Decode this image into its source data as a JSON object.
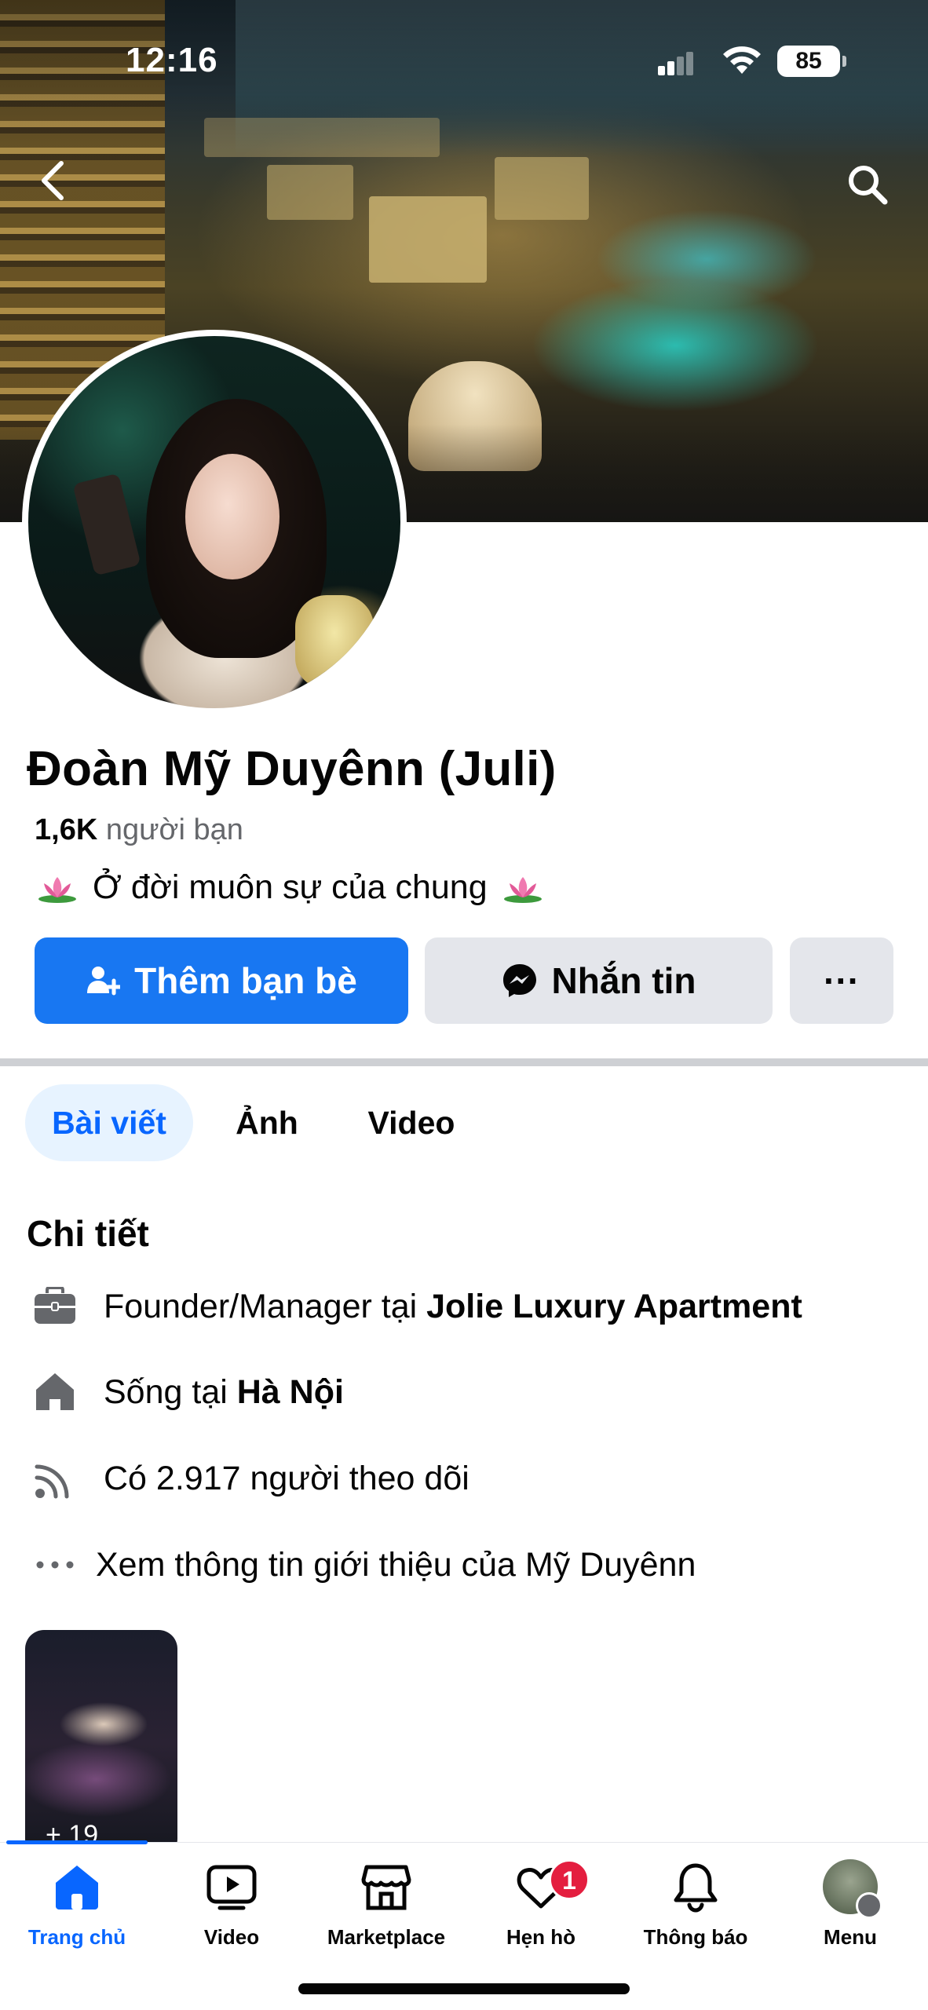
{
  "status_bar": {
    "time": "12:16",
    "battery": "85"
  },
  "profile": {
    "name": "Đoàn Mỹ Duyênn (Juli)",
    "friends_count": "1,6K",
    "friends_label": " người bạn",
    "bio": "Ở đời muôn sự của chung"
  },
  "actions": {
    "add_friend": "Thêm bạn bè",
    "message": "Nhắn tin",
    "more": "···"
  },
  "tabs": [
    {
      "label": "Bài viết",
      "active": true
    },
    {
      "label": "Ảnh",
      "active": false
    },
    {
      "label": "Video",
      "active": false
    }
  ],
  "details": {
    "title": "Chi tiết",
    "work_prefix": "Founder/Manager tại ",
    "work_place": "Jolie Luxury Apartment",
    "lives_prefix": "Sống tại ",
    "lives_place": "Hà Nội",
    "followers": "Có 2.917 người theo dõi",
    "see_about": "Xem thông tin giới thiệu của Mỹ Duyênn"
  },
  "photos": {
    "more_count": "+ 19"
  },
  "bottom_nav": {
    "items": [
      {
        "label": "Trang chủ",
        "icon": "home-icon",
        "active": true
      },
      {
        "label": "Video",
        "icon": "video-icon",
        "active": false
      },
      {
        "label": "Marketplace",
        "icon": "marketplace-icon",
        "active": false
      },
      {
        "label": "Hẹn hò",
        "icon": "dating-icon",
        "active": false,
        "badge": "1"
      },
      {
        "label": "Thông báo",
        "icon": "bell-icon",
        "active": false
      },
      {
        "label": "Menu",
        "icon": "menu-avatar-icon",
        "active": false
      }
    ]
  },
  "colors": {
    "primary": "#1877f2",
    "active_tab_bg": "#e7f3ff",
    "badge": "#e41e3f",
    "secondary_button": "#e4e6eb"
  }
}
